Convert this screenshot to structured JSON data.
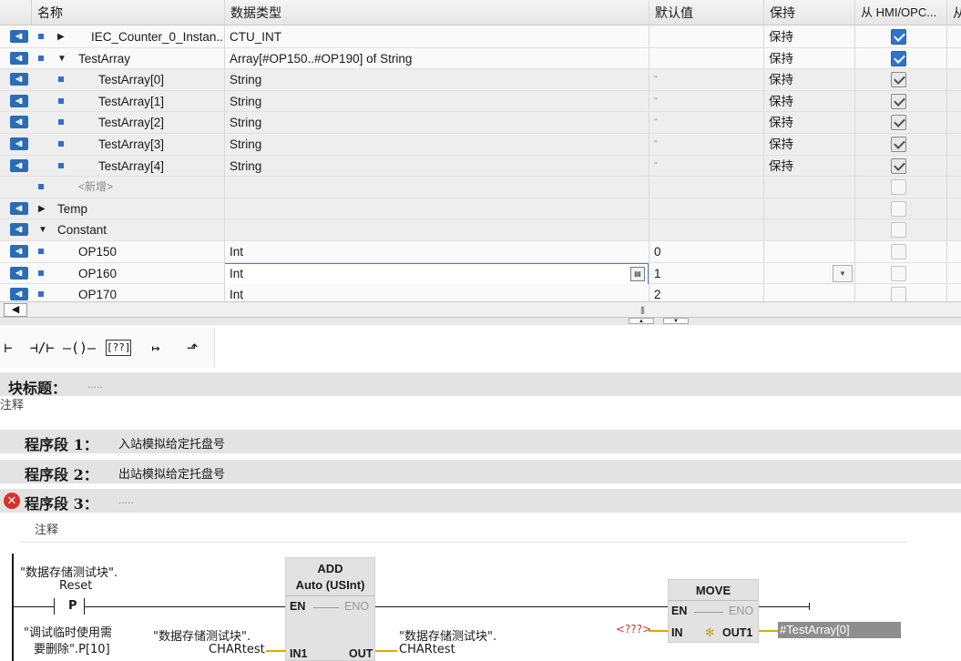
{
  "table": {
    "headers": [
      "名称",
      "数据类型",
      "默认值",
      "保持",
      "从 HMI/OPC...",
      "从"
    ],
    "rows": [
      {
        "name": "IEC_Counter_0_Instan...",
        "type": "CTU_INT",
        "default": "",
        "retain": "保持",
        "hmi": "checked"
      },
      {
        "name": "TestArray",
        "type": "Array[#OP150..#OP190] of String",
        "default": "",
        "retain": "保持",
        "hmi": "checked"
      },
      {
        "name": "TestArray[0]",
        "type": "String",
        "default": "''",
        "retain": "保持",
        "hmi": "grey"
      },
      {
        "name": "TestArray[1]",
        "type": "String",
        "default": "''",
        "retain": "保持",
        "hmi": "grey"
      },
      {
        "name": "TestArray[2]",
        "type": "String",
        "default": "''",
        "retain": "保持",
        "hmi": "grey"
      },
      {
        "name": "TestArray[3]",
        "type": "String",
        "default": "''",
        "retain": "保持",
        "hmi": "grey"
      },
      {
        "name": "TestArray[4]",
        "type": "String",
        "default": "''",
        "retain": "保持",
        "hmi": "grey"
      },
      {
        "name": "<新增>",
        "type": "",
        "default": "",
        "retain": "",
        "hmi": "empty"
      },
      {
        "name": "Temp",
        "type": "",
        "default": "",
        "retain": "",
        "hmi": "empty"
      },
      {
        "name": "Constant",
        "type": "",
        "default": "",
        "retain": "",
        "hmi": "empty"
      },
      {
        "name": "OP150",
        "type": "Int",
        "default": "0",
        "retain": "",
        "hmi": "empty"
      },
      {
        "name": "OP160",
        "type": "Int",
        "default": "1",
        "retain": "",
        "hmi": "empty"
      },
      {
        "name": "OP170",
        "type": "Int",
        "default": "2",
        "retain": "",
        "hmi": "empty"
      }
    ]
  },
  "toolbar": {
    "contact_no": "⊢",
    "contact_nc": "⊣/⊢",
    "coil": "–()–",
    "box": "[??]",
    "open_branch": "↦",
    "close_branch": "⬏"
  },
  "block": {
    "title_label": "块标题：",
    "title_value": ".....",
    "comment": "注释"
  },
  "networks": [
    {
      "label": "程序段 1：",
      "desc": "入站模拟给定托盘号"
    },
    {
      "label": "程序段 2：",
      "desc": "出站模拟给定托盘号"
    },
    {
      "label": "程序段 3：",
      "desc": ".....",
      "comment": "注释"
    }
  ],
  "ladder": {
    "contact_var_line1": "\"数据存储测试块\".",
    "contact_var_line2": "Reset",
    "contact_type": "P",
    "edge_var_line1": "\"调试临时使用需",
    "edge_var_line2": "要删除\".P[10]",
    "in1_var_line1": "\"数据存储测试块\".",
    "in1_var_line2": "CHARtest",
    "out_var_line1": "\"数据存储测试块\".",
    "out_var_line2": "CHARtest",
    "add_title": "ADD",
    "add_type": "Auto (USInt)",
    "en": "EN",
    "eno": "ENO",
    "in1": "IN1",
    "out": "OUT",
    "move_title": "MOVE",
    "move_in": "IN",
    "move_out": "OUT1",
    "move_in_var": "<???>",
    "move_out_var": "#TestArray[0]"
  },
  "colors": {
    "accent_blue": "#2f74cf",
    "error_red": "#d9322b",
    "placeholder_red": "#d9322b"
  }
}
